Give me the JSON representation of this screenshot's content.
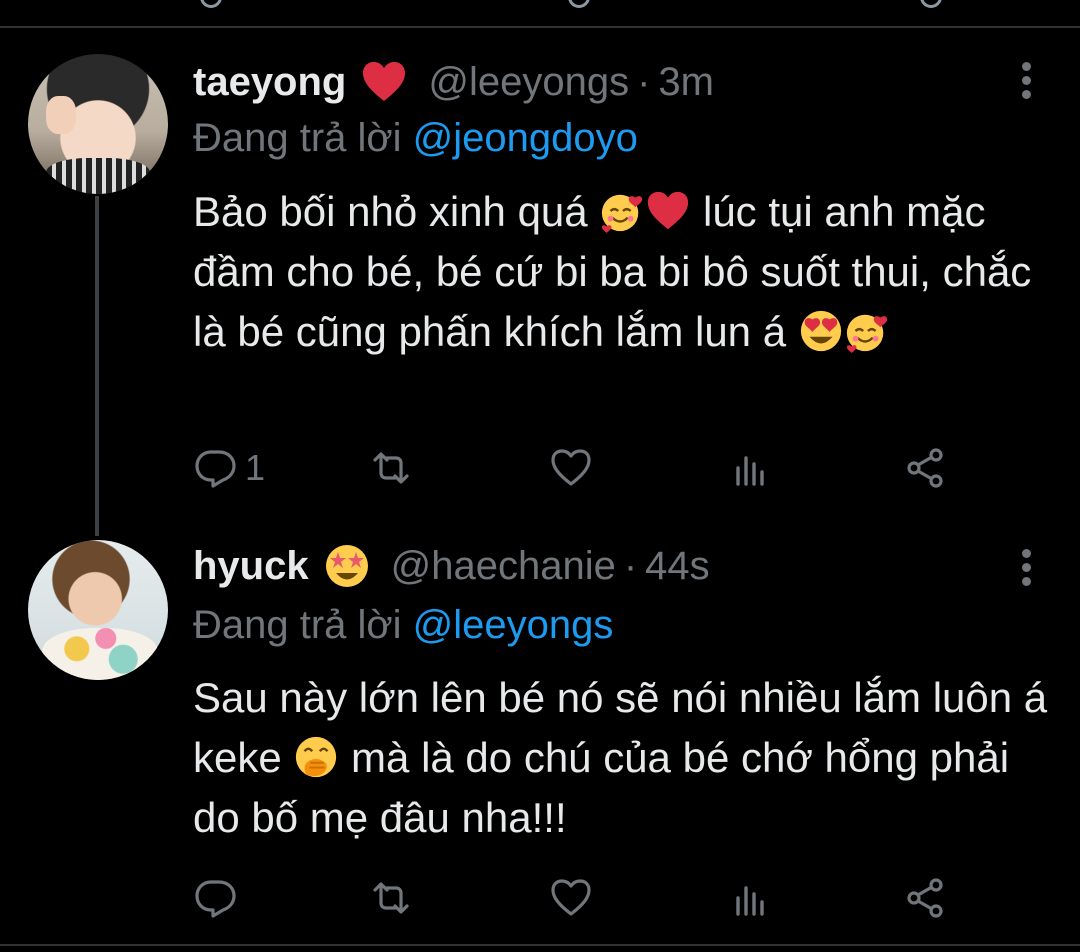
{
  "colors": {
    "background": "#000000",
    "text": "#e7e9ea",
    "muted": "#71767b",
    "accent": "#1d9bf0",
    "divider": "#2f3336"
  },
  "tweets": [
    {
      "display_name": "taeyong",
      "name_emoji": "red-heart",
      "handle": "@leeyongs",
      "separator": "·",
      "time": "3m",
      "replying_prefix": "Đang trả lời",
      "replying_to": "@jeongdoyo",
      "body_parts": [
        "Bảo bối nhỏ xinh quá ",
        " lúc tụi anh mặc đầm cho bé, bé cứ bi ba bi bô suốt thui, chắc là bé cũng phấn khích lắm lun á "
      ],
      "body_emojis": [
        "smiling-face-with-hearts",
        "red-heart",
        "heart-eyes",
        "smiling-face-with-hearts"
      ],
      "reply_count": "1",
      "icons": [
        "reply-icon",
        "retweet-icon",
        "like-icon",
        "stats-icon",
        "share-icon",
        "more-icon"
      ]
    },
    {
      "display_name": "hyuck",
      "name_emoji": "star-struck",
      "handle": "@haechanie",
      "separator": "·",
      "time": "44s",
      "replying_prefix": "Đang trả lời",
      "replying_to": "@leeyongs",
      "body_parts": [
        "Sau này lớn lên bé nó sẽ nói nhiều lắm luôn á keke ",
        " mà là do chú của bé chớ hổng phải do bố mẹ đâu nha!!!"
      ],
      "body_emojis": [
        "face-with-hand-over-mouth"
      ],
      "reply_count": "",
      "icons": [
        "reply-icon",
        "retweet-icon",
        "like-icon",
        "stats-icon",
        "share-icon",
        "more-icon"
      ]
    }
  ]
}
